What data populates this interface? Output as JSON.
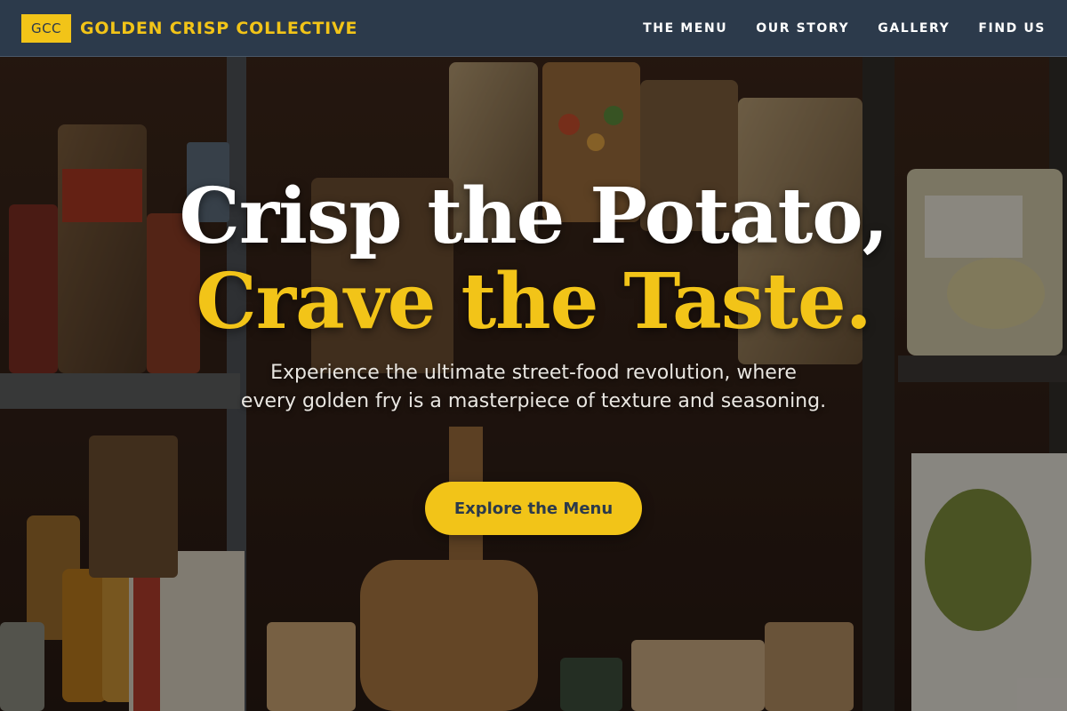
{
  "header": {
    "logo_badge": "GCC",
    "brand_name": "GOLDEN CRISP COLLECTIVE",
    "nav": [
      {
        "label": "THE MENU"
      },
      {
        "label": "OUR STORY"
      },
      {
        "label": "GALLERY"
      },
      {
        "label": "FIND US"
      }
    ]
  },
  "hero": {
    "headline_line1": "Crisp the Potato,",
    "headline_line2": "Crave the Taste.",
    "subtitle": "Experience the ultimate street-food revolution, where every golden fry is a masterpiece of texture and seasoning.",
    "cta_label": "Explore the Menu"
  },
  "colors": {
    "accent": "#f2c418",
    "nav_background": "#2c3a4b",
    "headline_white": "#ffffff",
    "subtitle_text": "#e9e6e1"
  }
}
